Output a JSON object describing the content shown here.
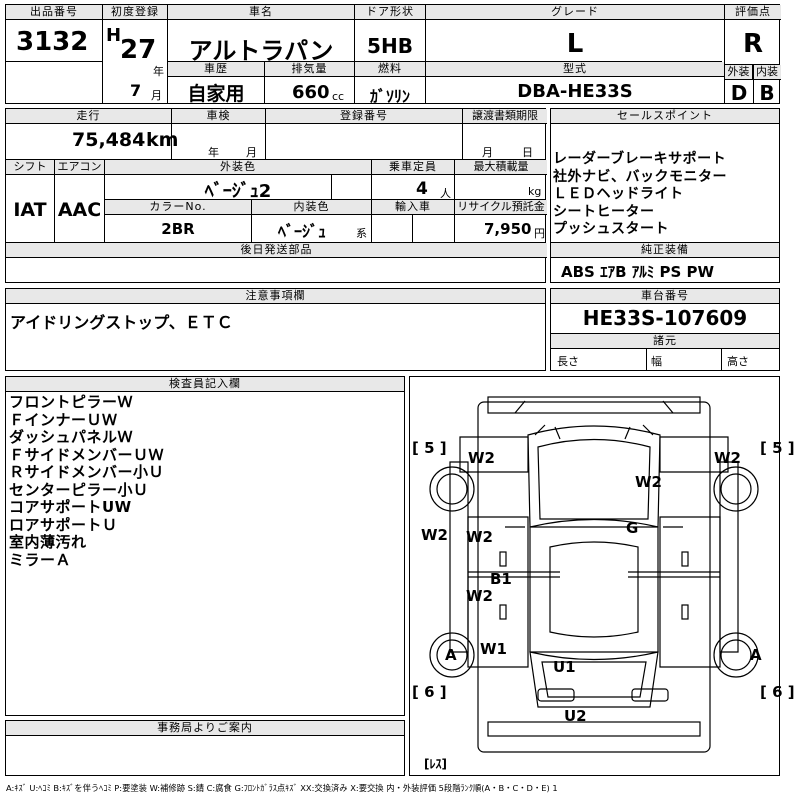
{
  "header": {
    "lot_label": "出品番号",
    "lot": "3132",
    "first_reg_label": "初度登録",
    "era": "H",
    "year": "27",
    "year_unit": "年",
    "month": "7",
    "month_unit": "月",
    "name_label": "車名",
    "name": "アルトラパン",
    "door_label": "ドア形状",
    "door": "5HB",
    "grade_label": "グレード",
    "grade": "L",
    "score_label": "評価点",
    "score": "R",
    "history_label": "車歴",
    "history": "自家用",
    "disp_label": "排気量",
    "disp": "660",
    "disp_unit": "cc",
    "fuel_label": "燃料",
    "fuel": "ｶﾞｿﾘﾝ",
    "model_label": "型式",
    "model": "DBA-HE33S",
    "ext_label": "外装",
    "ext": "D",
    "int_label": "内装",
    "int": "B"
  },
  "row2": {
    "mileage_label": "走行",
    "mileage": "75,484",
    "mileage_unit": "km",
    "inspect_label": "車検",
    "inspect_year": "年",
    "inspect_month": "月",
    "regno_label": "登録番号",
    "transfer_label": "譲渡書類期限",
    "transfer_month": "月",
    "transfer_day": "日",
    "shift_label": "シフト",
    "shift": "IAT",
    "ac_label": "エアコン",
    "ac": "AAC",
    "color_label": "外装色",
    "color": "ﾍﾞｰｼﾞｭ2",
    "capacity_label": "乗車定員",
    "capacity": "4",
    "capacity_unit": "人",
    "load_label": "最大積載量",
    "load_unit": "kg",
    "colorno_label": "カラーNo.",
    "colorno": "2BR",
    "intcolor_label": "内装色",
    "intcolor": "ﾍﾞｰｼﾞｭ",
    "intcolor_unit": "系",
    "import_label": "輸入車",
    "recycle_label": "リサイクル預託金",
    "recycle": "7,950",
    "recycle_unit": "円",
    "later_label": "後日発送部品"
  },
  "sales": {
    "label": "セールスポイント",
    "items": [
      "レーダーブレーキサポート",
      "社外ナビ、バックモニター",
      "ＬＥＤヘッドライト",
      "シートヒーター",
      "プッシュスタート"
    ],
    "equip_label": "純正装備",
    "equip": "ABS ｴｱB ｱﾙﾐ PS PW"
  },
  "notes": {
    "label": "注意事項欄",
    "text": "アイドリングストップ、ＥＴＣ",
    "chassis_label": "車台番号",
    "chassis": "HE33S-107609",
    "dims_label": "諸元",
    "len": "長さ",
    "wid": "幅",
    "hei": "高さ"
  },
  "inspector": {
    "label": "検査員記入欄",
    "items": [
      "フロントピラーＷ",
      "ＦインナーＵＷ",
      "ダッシュパネルＷ",
      "ＦサイドメンバーＵＷ",
      "Ｒサイドメンバー小Ｕ",
      "センターピラー小Ｕ",
      "コアサポートUW",
      "ロアサポートＵ",
      "室内薄汚れ",
      "ミラーＡ"
    ]
  },
  "office": {
    "label": "事務局よりご案内"
  },
  "diagram": {
    "tl": "[ 5 ]",
    "tr": "[ 5 ]",
    "bl": "[ 6 ]",
    "br": "[ 6 ]",
    "w2_fl": "W2",
    "w2_fr": "W2",
    "w2_hood": "W2",
    "g": "G",
    "w2_l": "W2",
    "w2_d1": "W2",
    "b1": "B1",
    "w2_d2": "W2",
    "a_l": "A",
    "a_r": "A",
    "w1": "W1",
    "u1": "U1",
    "u2": "U2",
    "less": "[ﾚｽ]"
  },
  "legend": "A:ｷｽﾞ U:ﾍｺﾐ B:ｷｽﾞを伴うﾍｺﾐ P:要塗装 W:補修跡 S:錆 C:腐食 G:ﾌﾛﾝﾄｶﾞﾗｽ点ｷｽﾞ XX:交換済み X:要交換 内・外装評価 5段階ﾗﾝｸ順(A・B・C・D・E) 1"
}
